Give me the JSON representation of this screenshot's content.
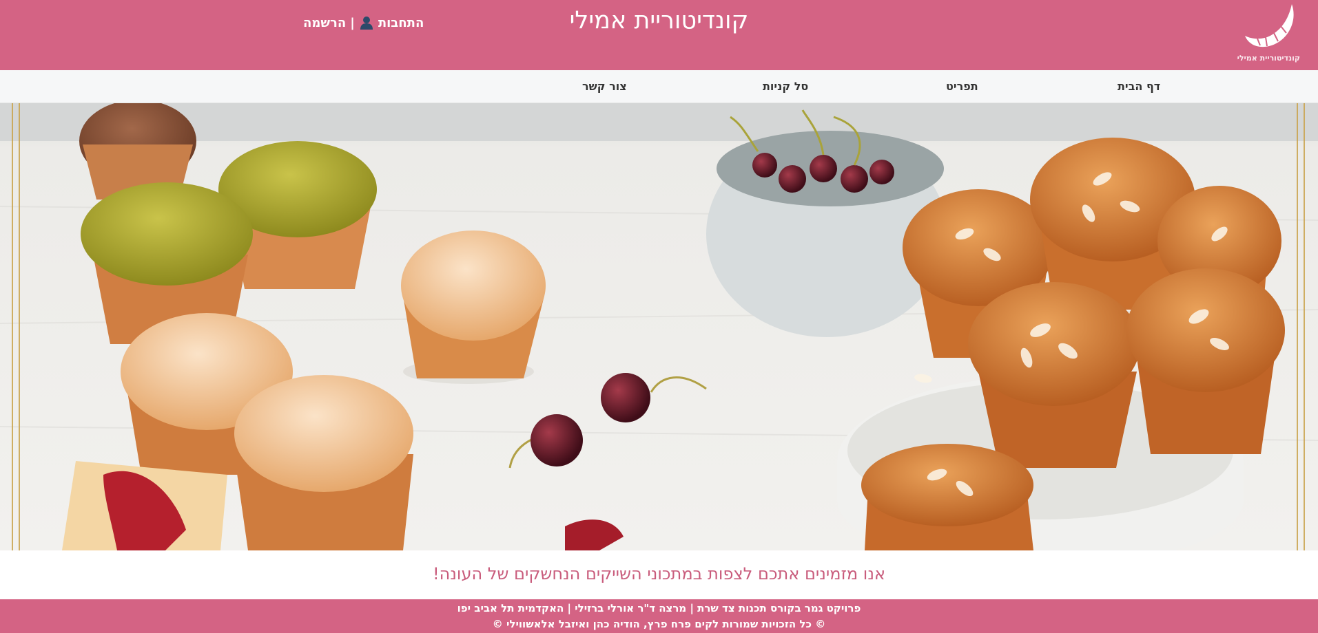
{
  "header": {
    "logo_text": "קונדיטוריית אמילי",
    "title": "קונדיטוריית אמילי",
    "login_label": "התחבות",
    "separator": "|",
    "register_label": "הרשמה",
    "brand_color": "#d46384"
  },
  "nav": {
    "items": [
      {
        "label": "דף הבית"
      },
      {
        "label": "תפריט"
      },
      {
        "label": "סל קניות"
      },
      {
        "label": "צור קשר"
      }
    ]
  },
  "main": {
    "tagline": "אנו מזמינים אתכם לצפות במתכוני השייקים הנחשקים של העונה!"
  },
  "footer": {
    "line1": "פרויקט גמר בקורס תכנות צד שרת | מרצה ד\"ר אורלי ברזילי | האקדמית תל אביב יפו",
    "line2": "© כל הזכויות שמורות לקים פרח פרץ, הודיה כהן ואיזבל אלאשווילי ©"
  }
}
